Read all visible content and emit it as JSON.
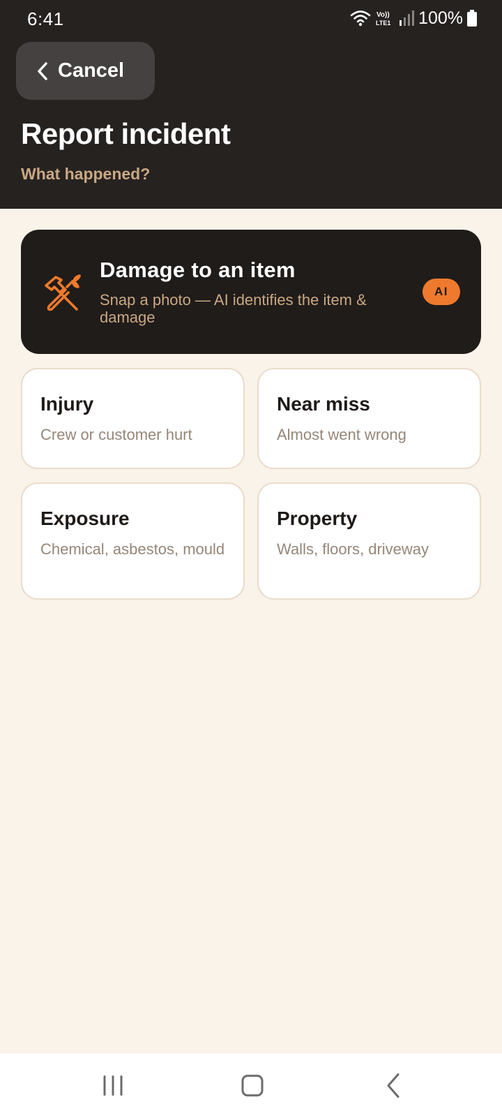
{
  "status_bar": {
    "time": "6:41",
    "battery": "100%",
    "icons": [
      "wifi-icon",
      "volte-icon",
      "signal-icon",
      "battery-icon"
    ],
    "volte_label": "Vo)) LTE1"
  },
  "header": {
    "cancel_label": "Cancel",
    "title": "Report incident",
    "subtitle": "What happened?"
  },
  "hero_option": {
    "icon": "tools-icon",
    "title": "Damage to an item",
    "description": "Snap a photo — AI identifies the item & damage",
    "badge": "AI"
  },
  "options": [
    {
      "title": "Injury",
      "description": "Crew or customer hurt"
    },
    {
      "title": "Near miss",
      "description": "Almost went wrong"
    },
    {
      "title": "Exposure",
      "description": "Chemical, asbestos, mould"
    },
    {
      "title": "Property",
      "description": "Walls, floors, driveway"
    }
  ],
  "nav_bar": {
    "items": [
      "recents-icon",
      "home-icon",
      "back-icon"
    ]
  },
  "colors": {
    "header_bg": "#262220",
    "page_bg": "#faf3ea",
    "accent": "#ef7a2d",
    "muted_text": "#c9a883"
  }
}
